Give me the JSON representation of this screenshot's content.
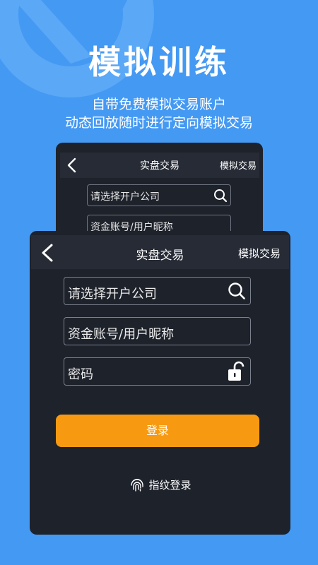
{
  "hero": {
    "title": "模拟训练",
    "subtitle_line1": "自带免费模拟交易账户",
    "subtitle_line2": "动态回放随时进行定向模拟交易"
  },
  "back_card": {
    "nav_title": "实盘交易",
    "nav_right": "模拟交易",
    "broker_placeholder": "请选择开户公司",
    "account_placeholder": "资金账号/用户昵称"
  },
  "front_card": {
    "nav_title": "实盘交易",
    "nav_right": "模拟交易",
    "broker_placeholder": "请选择开户公司",
    "account_placeholder": "资金账号/用户昵称",
    "password_placeholder": "密码",
    "login_label": "登录",
    "fingerprint_label": "指纹登录"
  },
  "colors": {
    "background": "#4499f3",
    "card": "#1e222b",
    "accent": "#f79a11"
  }
}
